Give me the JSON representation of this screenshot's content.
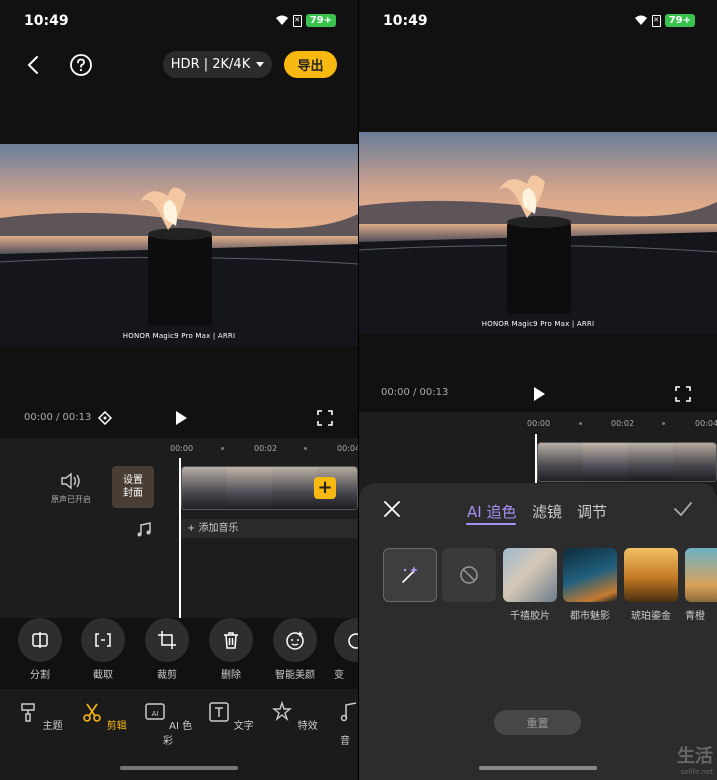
{
  "left": {
    "status": {
      "time": "10:49",
      "battery": "79+"
    },
    "topbar": {
      "quality": "HDR | 2K/4K",
      "export": "导出"
    },
    "preview": {
      "caption": "HONOR Magic9 Pro Max  |  ARRI"
    },
    "player": {
      "timecode": "00:00 / 00:13"
    },
    "timeline": {
      "ruler": [
        "00:00",
        "00:02",
        "00:04"
      ],
      "audio_label": "原声已开启",
      "cover": "设置\n封面",
      "add_music": "+ 添加音乐",
      "add_clip": "+"
    },
    "tools": [
      {
        "label": "分割",
        "icon": "split-icon"
      },
      {
        "label": "截取",
        "icon": "trim-icon"
      },
      {
        "label": "裁剪",
        "icon": "crop-icon"
      },
      {
        "label": "删除",
        "icon": "trash-icon"
      },
      {
        "label": "智能美颜",
        "icon": "beauty-icon"
      },
      {
        "label": "变",
        "icon": "speed-icon"
      }
    ],
    "nav": [
      {
        "label": "主题",
        "icon": "theme-icon"
      },
      {
        "label": "剪辑",
        "icon": "scissors-icon",
        "active": true
      },
      {
        "label": "AI 色彩",
        "icon": "ai-color-icon"
      },
      {
        "label": "文字",
        "icon": "text-icon"
      },
      {
        "label": "特效",
        "icon": "effects-icon"
      },
      {
        "label": "音",
        "icon": "music-icon"
      }
    ]
  },
  "right": {
    "status": {
      "time": "10:49",
      "battery": "79+"
    },
    "preview": {
      "caption": "HONOR Magic9 Pro Max  |  ARRI"
    },
    "player": {
      "timecode": "00:00 / 00:13"
    },
    "timeline": {
      "ruler": [
        "00:00",
        "00:02",
        "00:04"
      ]
    },
    "panel": {
      "tabs": [
        "AI 追色",
        "滤镜",
        "调节"
      ],
      "active_tab": 0,
      "filters": [
        "千禧胶片",
        "都市魅影",
        "琥珀鎏金",
        "青橙"
      ],
      "reset": "重置"
    },
    "watermark": {
      "brand": "生活",
      "url": "selife.net"
    }
  },
  "colors": {
    "accent": "#f8b812",
    "tab_active": "#a88ff5",
    "battery": "#39c34e"
  }
}
